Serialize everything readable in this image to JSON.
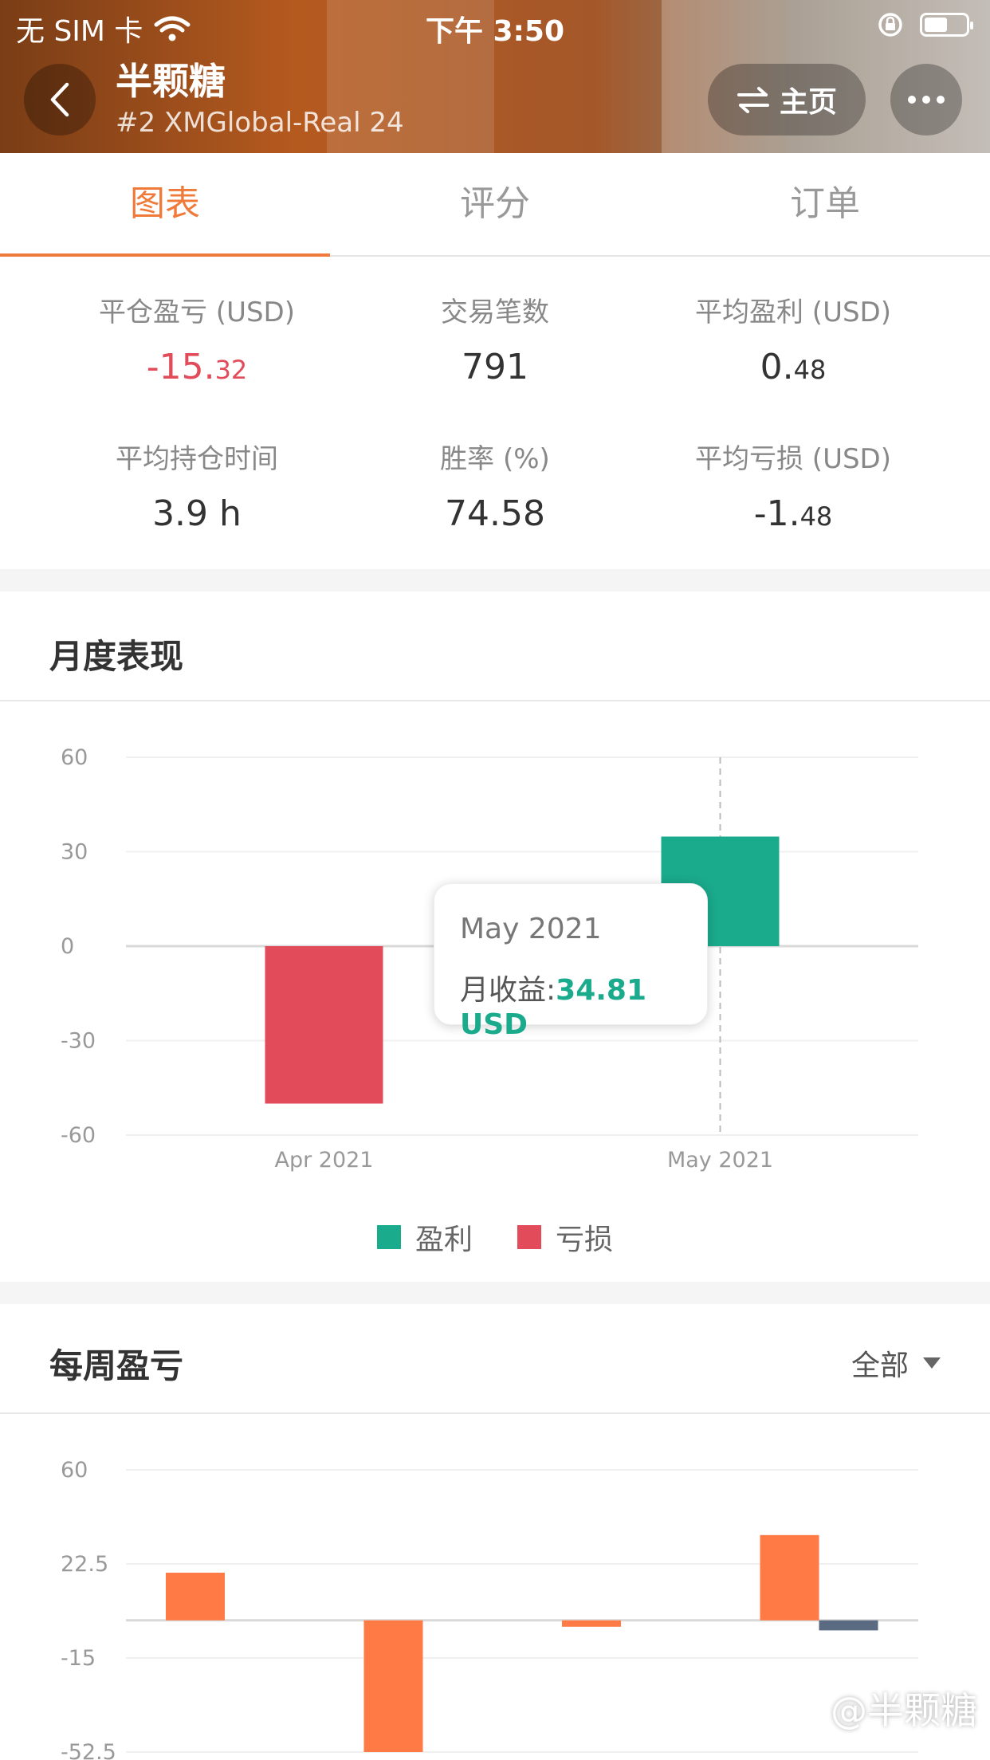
{
  "status_bar": {
    "carrier": "无 SIM 卡",
    "time": "下午 3:50"
  },
  "header": {
    "title": "半颗糖",
    "subtitle": "#2 XMGlobal-Real 24",
    "home_label": "主页"
  },
  "tabs": [
    {
      "label": "图表",
      "active": true
    },
    {
      "label": "评分",
      "active": false
    },
    {
      "label": "订单",
      "active": false
    }
  ],
  "stats": {
    "closed_pnl": {
      "label": "平仓盈亏 (USD)",
      "int": "-15.",
      "dec": "32"
    },
    "trade_count": {
      "label": "交易笔数",
      "value": "791"
    },
    "avg_profit": {
      "label": "平均盈利 (USD)",
      "int": "0.",
      "dec": "48"
    },
    "avg_hold": {
      "label": "平均持仓时间",
      "value": "3.9 h"
    },
    "win_rate": {
      "label": "胜率 (%)",
      "value": "74.58"
    },
    "avg_loss": {
      "label": "平均亏损 (USD)",
      "int": "-1.",
      "dec": "48"
    }
  },
  "monthly": {
    "title": "月度表现",
    "tooltip": {
      "month": "May 2021",
      "label": "月收益:",
      "value": "34.81 USD"
    },
    "legend": {
      "profit": "盈利",
      "loss": "亏损"
    }
  },
  "weekly": {
    "title": "每周盈亏",
    "filter": "全部"
  },
  "watermark": "@半颗糖",
  "colors": {
    "accent": "#f07a3a",
    "profit": "#1aaa8c",
    "loss": "#e14b5a",
    "weekly_bar": "#ff7a45",
    "weekly_neg": "#5a6a80"
  },
  "chart_data": [
    {
      "type": "bar",
      "title": "月度表现",
      "categories": [
        "Apr 2021",
        "May 2021"
      ],
      "values": [
        -50,
        34.81
      ],
      "ylim": [
        -60,
        60
      ],
      "yticks": [
        60,
        30,
        0,
        -30,
        -60
      ],
      "grid": true,
      "legend": "bottom"
    },
    {
      "type": "bar",
      "title": "每周盈亏",
      "groups": [
        {
          "values": [
            19
          ]
        },
        {
          "values": [
            -52.5
          ]
        },
        {
          "values": [
            -2.5
          ]
        },
        {
          "values": [
            34,
            -4
          ]
        }
      ],
      "ylim": [
        -52.5,
        60
      ],
      "yticks": [
        60,
        22.5,
        -15,
        -52.5
      ],
      "grid": true
    }
  ]
}
